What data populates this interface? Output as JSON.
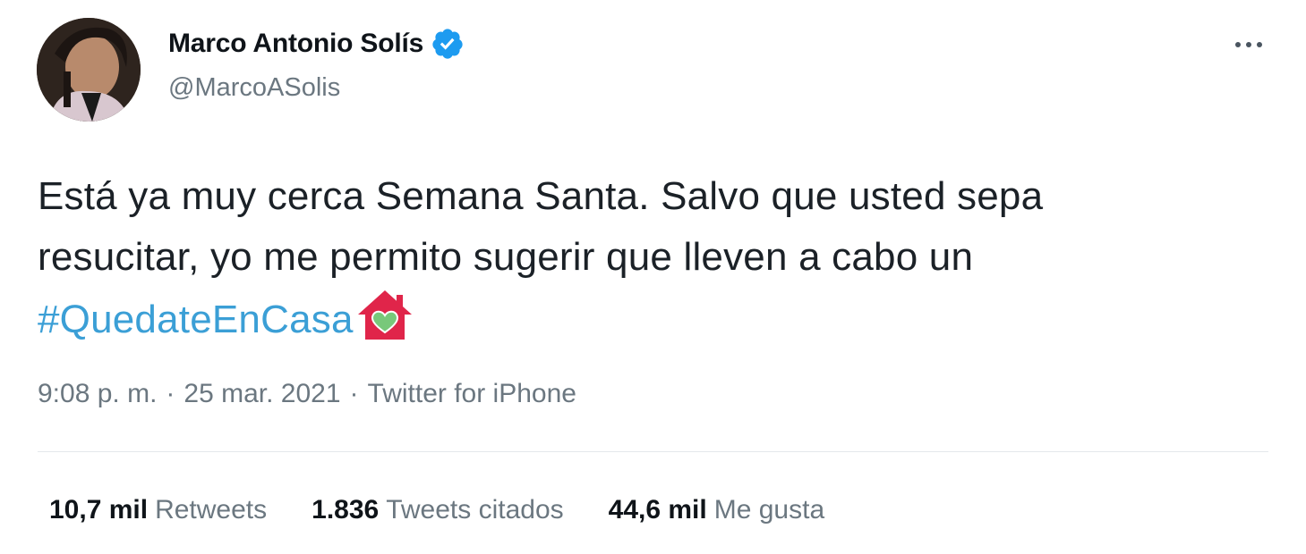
{
  "author": {
    "name": "Marco Antonio Solís",
    "handle": "@MarcoASolis",
    "verified": true
  },
  "tweet": {
    "lines": [
      "Está ya muy cerca Semana Santa. Salvo que usted sepa",
      "resucitar, yo me permito sugerir que lleven a cabo un"
    ],
    "hashtag": "#QuedateEnCasa",
    "emoji": "house-with-green-heart"
  },
  "meta": {
    "time": "9:08 p. m.",
    "separator": "·",
    "date": "25 mar. 2021",
    "source": "Twitter for iPhone"
  },
  "stats": {
    "retweets_count": "10,7 mil",
    "retweets_label": "Retweets",
    "quotes_count": "1.836",
    "quotes_label": "Tweets citados",
    "likes_count": "44,6 mil",
    "likes_label": "Me gusta"
  },
  "colors": {
    "link": "#3b9fd6",
    "verified": "#1d9bf0",
    "secondary_text": "#6b7780",
    "house": "#e0254a",
    "heart": "#78c87a"
  }
}
